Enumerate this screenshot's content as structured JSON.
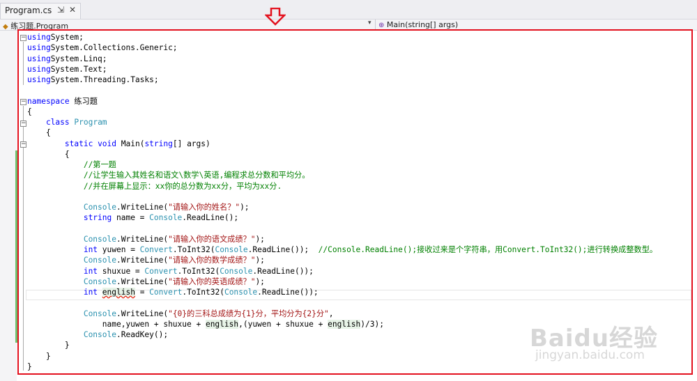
{
  "tab": {
    "title": "Program.cs",
    "pin_icon": "pin-icon",
    "close_icon": "close-icon",
    "pin_glyph": "⇲",
    "close_glyph": "✕"
  },
  "navbar": {
    "type_scope": "练习题.Program",
    "member_scope": "Main(string[] args)"
  },
  "code_lines": [
    [
      [
        "k",
        "using"
      ],
      [
        "",
        "System;"
      ]
    ],
    [
      [
        "k",
        "using"
      ],
      [
        "",
        "System.Collections.Generic;"
      ]
    ],
    [
      [
        "k",
        "using"
      ],
      [
        "",
        "System.Linq;"
      ]
    ],
    [
      [
        "k",
        "using"
      ],
      [
        "",
        "System.Text;"
      ]
    ],
    [
      [
        "k",
        "using"
      ],
      [
        "",
        "System.Threading.Tasks;"
      ]
    ],
    [],
    [
      [
        "k",
        "namespace"
      ],
      [
        "",
        " 练习题"
      ]
    ],
    [
      [
        "",
        "{"
      ]
    ],
    [
      [
        "",
        "    "
      ],
      [
        "k",
        "class"
      ],
      [
        "",
        " "
      ],
      [
        "t",
        "Program"
      ]
    ],
    [
      [
        "",
        "    {"
      ]
    ],
    [
      [
        "",
        "        "
      ],
      [
        "k",
        "static"
      ],
      [
        "",
        " "
      ],
      [
        "k",
        "void"
      ],
      [
        "",
        " Main("
      ],
      [
        "k",
        "string"
      ],
      [
        "",
        "[] args)"
      ]
    ],
    [
      [
        "",
        "        {"
      ]
    ],
    [
      [
        "",
        "            "
      ],
      [
        "c",
        "//第一题"
      ]
    ],
    [
      [
        "",
        "            "
      ],
      [
        "c",
        "//让学生输入其姓名和语文\\数学\\英语,编程求总分数和平均分。"
      ]
    ],
    [
      [
        "",
        "            "
      ],
      [
        "c",
        "//并在屏幕上显示：xx你的总分数为xx分，平均为xx分."
      ]
    ],
    [],
    [
      [
        "",
        "            "
      ],
      [
        "t",
        "Console"
      ],
      [
        "",
        ".WriteLine("
      ],
      [
        "s",
        "\"请输入你的姓名？\""
      ],
      [
        "",
        ");"
      ]
    ],
    [
      [
        "",
        "            "
      ],
      [
        "k",
        "string"
      ],
      [
        "",
        " name = "
      ],
      [
        "t",
        "Console"
      ],
      [
        "",
        ".ReadLine();"
      ]
    ],
    [],
    [
      [
        "",
        "            "
      ],
      [
        "t",
        "Console"
      ],
      [
        "",
        ".WriteLine("
      ],
      [
        "s",
        "\"请输入你的语文成绩？\""
      ],
      [
        "",
        ");"
      ]
    ],
    [
      [
        "",
        "            "
      ],
      [
        "k",
        "int"
      ],
      [
        "",
        " yuwen = "
      ],
      [
        "t",
        "Convert"
      ],
      [
        "",
        ".ToInt32("
      ],
      [
        "t",
        "Console"
      ],
      [
        "",
        ".ReadLine());  "
      ],
      [
        "c",
        "//Console.ReadLine();接收过来是个字符串，用Convert.ToInt32();进行转换成整数型。"
      ]
    ],
    [
      [
        "",
        "            "
      ],
      [
        "t",
        "Console"
      ],
      [
        "",
        ".WriteLine("
      ],
      [
        "s",
        "\"请输入你的数学成绩？\""
      ],
      [
        "",
        ");"
      ]
    ],
    [
      [
        "",
        "            "
      ],
      [
        "k",
        "int"
      ],
      [
        "",
        " shuxue = "
      ],
      [
        "t",
        "Convert"
      ],
      [
        "",
        ".ToInt32("
      ],
      [
        "t",
        "Console"
      ],
      [
        "",
        ".ReadLine());"
      ]
    ],
    [
      [
        "",
        "            "
      ],
      [
        "t",
        "Console"
      ],
      [
        "",
        ".WriteLine("
      ],
      [
        "s",
        "\"请输入你的英语成绩？\""
      ],
      [
        "",
        ");"
      ]
    ],
    [
      [
        "",
        "            "
      ],
      [
        "k",
        "int"
      ],
      [
        "",
        " "
      ],
      [
        "hlsq",
        "english"
      ],
      [
        "",
        " = "
      ],
      [
        "t",
        "Convert"
      ],
      [
        "",
        ".ToInt32("
      ],
      [
        "t",
        "Console"
      ],
      [
        "",
        ".ReadLine());"
      ]
    ],
    [],
    [
      [
        "",
        "            "
      ],
      [
        "t",
        "Console"
      ],
      [
        "",
        ".WriteLine("
      ],
      [
        "s",
        "\"{0}的三科总成绩为{1}分，平均分为{2}分\""
      ],
      [
        "",
        ","
      ]
    ],
    [
      [
        "",
        "                name,yuwen + shuxue + "
      ],
      [
        "hl",
        "english"
      ],
      [
        "",
        ",(yuwen + shuxue + "
      ],
      [
        "hl",
        "english"
      ],
      [
        "",
        ")/3);"
      ]
    ],
    [
      [
        "",
        "            "
      ],
      [
        "t",
        "Console"
      ],
      [
        "",
        ".ReadKey();"
      ]
    ],
    [
      [
        "",
        "        }"
      ]
    ],
    [
      [
        "",
        "    }"
      ]
    ],
    [
      [
        "",
        "}"
      ]
    ]
  ],
  "watermark": {
    "main": "Baidu经验",
    "sub": "jingyan.baidu.com"
  },
  "colors": {
    "keyword": "#0000ff",
    "type": "#2b91af",
    "string": "#a31515",
    "comment": "#008000",
    "annotation_box": "#e3101d",
    "change_bar": "#6fc06e"
  }
}
